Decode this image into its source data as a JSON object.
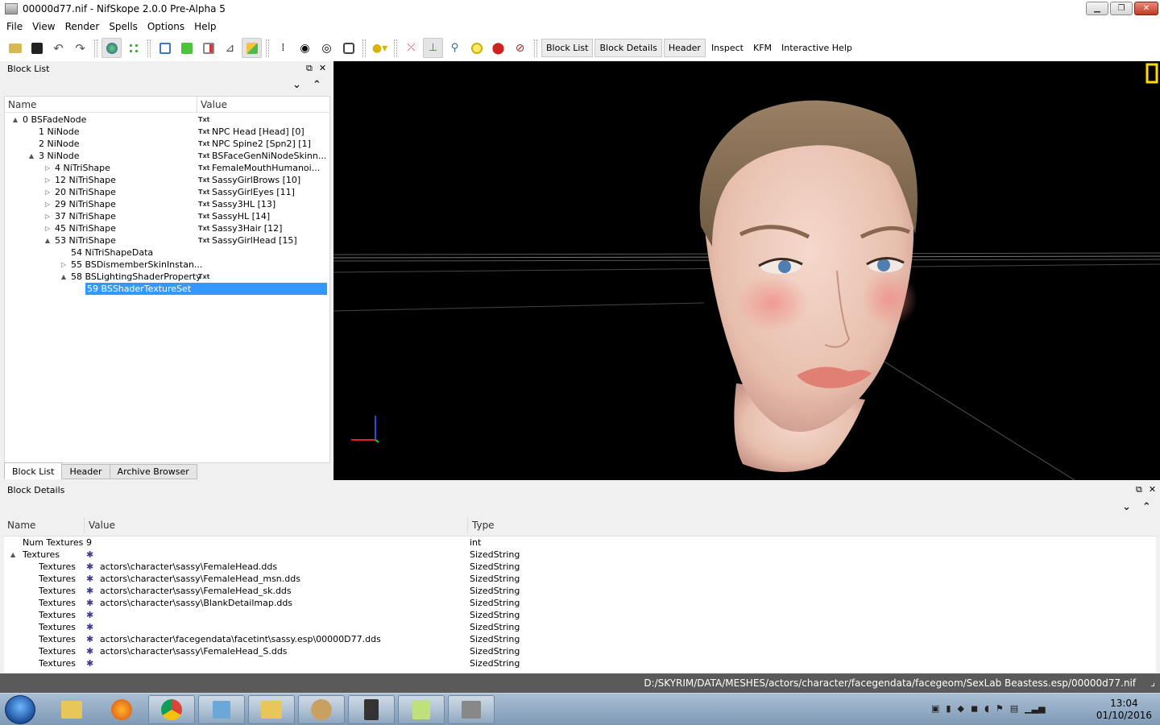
{
  "window": {
    "title": "00000d77.nif - NifSkope 2.0.0 Pre-Alpha 5"
  },
  "menu": [
    "File",
    "View",
    "Render",
    "Spells",
    "Options",
    "Help"
  ],
  "toolbar": {
    "text_buttons": [
      "Block List",
      "Block Details",
      "Header",
      "Inspect",
      "KFM",
      "Interactive Help"
    ]
  },
  "block_list": {
    "title": "Block List",
    "col_name": "Name",
    "col_value": "Value",
    "rows": [
      {
        "name": "0 BSFadeNode",
        "value": "",
        "txt": "Txt",
        "exp": "▲"
      },
      {
        "name": "1 NiNode",
        "value": "NPC Head [Head] [0]",
        "txt": "Txt",
        "exp": ""
      },
      {
        "name": "2 NiNode",
        "value": "NPC Spine2 [Spn2] [1]",
        "txt": "Txt",
        "exp": ""
      },
      {
        "name": "3 NiNode",
        "value": "BSFaceGenNiNodeSkinn...",
        "txt": "Txt",
        "exp": "▲"
      },
      {
        "name": "4 NiTriShape",
        "value": "FemaleMouthHumanoi...",
        "txt": "Txt",
        "exp": "▷"
      },
      {
        "name": "12 NiTriShape",
        "value": "SassyGirlBrows [10]",
        "txt": "Txt",
        "exp": "▷"
      },
      {
        "name": "20 NiTriShape",
        "value": "SassyGirlEyes [11]",
        "txt": "Txt",
        "exp": "▷"
      },
      {
        "name": "29 NiTriShape",
        "value": "Sassy3HL [13]",
        "txt": "Txt",
        "exp": "▷"
      },
      {
        "name": "37 NiTriShape",
        "value": "SassyHL [14]",
        "txt": "Txt",
        "exp": "▷"
      },
      {
        "name": "45 NiTriShape",
        "value": "Sassy3Hair [12]",
        "txt": "Txt",
        "exp": "▷"
      },
      {
        "name": "53 NiTriShape",
        "value": "SassyGirlHead [15]",
        "txt": "Txt",
        "exp": "▲"
      },
      {
        "name": "54 NiTriShapeData",
        "value": "",
        "txt": "",
        "exp": ""
      },
      {
        "name": "55 BSDismemberSkinInstan...",
        "value": "",
        "txt": "",
        "exp": "▷"
      },
      {
        "name": "58 BSLightingShaderProperty",
        "value": "",
        "txt": "Txt",
        "exp": "▲"
      },
      {
        "name": "59 BSShaderTextureSet",
        "value": "",
        "txt": "",
        "exp": ""
      }
    ],
    "tabs": [
      "Block List",
      "Header",
      "Archive Browser"
    ]
  },
  "block_details": {
    "title": "Block Details",
    "col_name": "Name",
    "col_value": "Value",
    "col_type": "Type",
    "rows": [
      {
        "name": "Num Textures",
        "value": "9",
        "type": "int",
        "gear": false
      },
      {
        "name": "Textures",
        "value": "",
        "type": "SizedString",
        "gear": true,
        "exp": "▲"
      },
      {
        "name": "Textures",
        "value": "actors\\character\\sassy\\FemaleHead.dds",
        "type": "SizedString",
        "gear": true
      },
      {
        "name": "Textures",
        "value": "actors\\character\\sassy\\FemaleHead_msn.dds",
        "type": "SizedString",
        "gear": true
      },
      {
        "name": "Textures",
        "value": "actors\\character\\sassy\\FemaleHead_sk.dds",
        "type": "SizedString",
        "gear": true
      },
      {
        "name": "Textures",
        "value": "actors\\character\\sassy\\BlankDetailmap.dds",
        "type": "SizedString",
        "gear": true
      },
      {
        "name": "Textures",
        "value": "",
        "type": "SizedString",
        "gear": true
      },
      {
        "name": "Textures",
        "value": "",
        "type": "SizedString",
        "gear": true
      },
      {
        "name": "Textures",
        "value": "actors\\character\\facegendata\\facetint\\sassy.esp\\00000D77.dds",
        "type": "SizedString",
        "gear": true
      },
      {
        "name": "Textures",
        "value": "actors\\character\\sassy\\FemaleHead_S.dds",
        "type": "SizedString",
        "gear": true
      },
      {
        "name": "Textures",
        "value": "",
        "type": "SizedString",
        "gear": true
      }
    ]
  },
  "status": {
    "path": "D:/SKYRIM/DATA/MESHES/actors/character/facegendata/facegeom/SexLab Beastess.esp/00000d77.nif"
  },
  "clock": {
    "time": "13:04",
    "date": "01/10/2016"
  }
}
